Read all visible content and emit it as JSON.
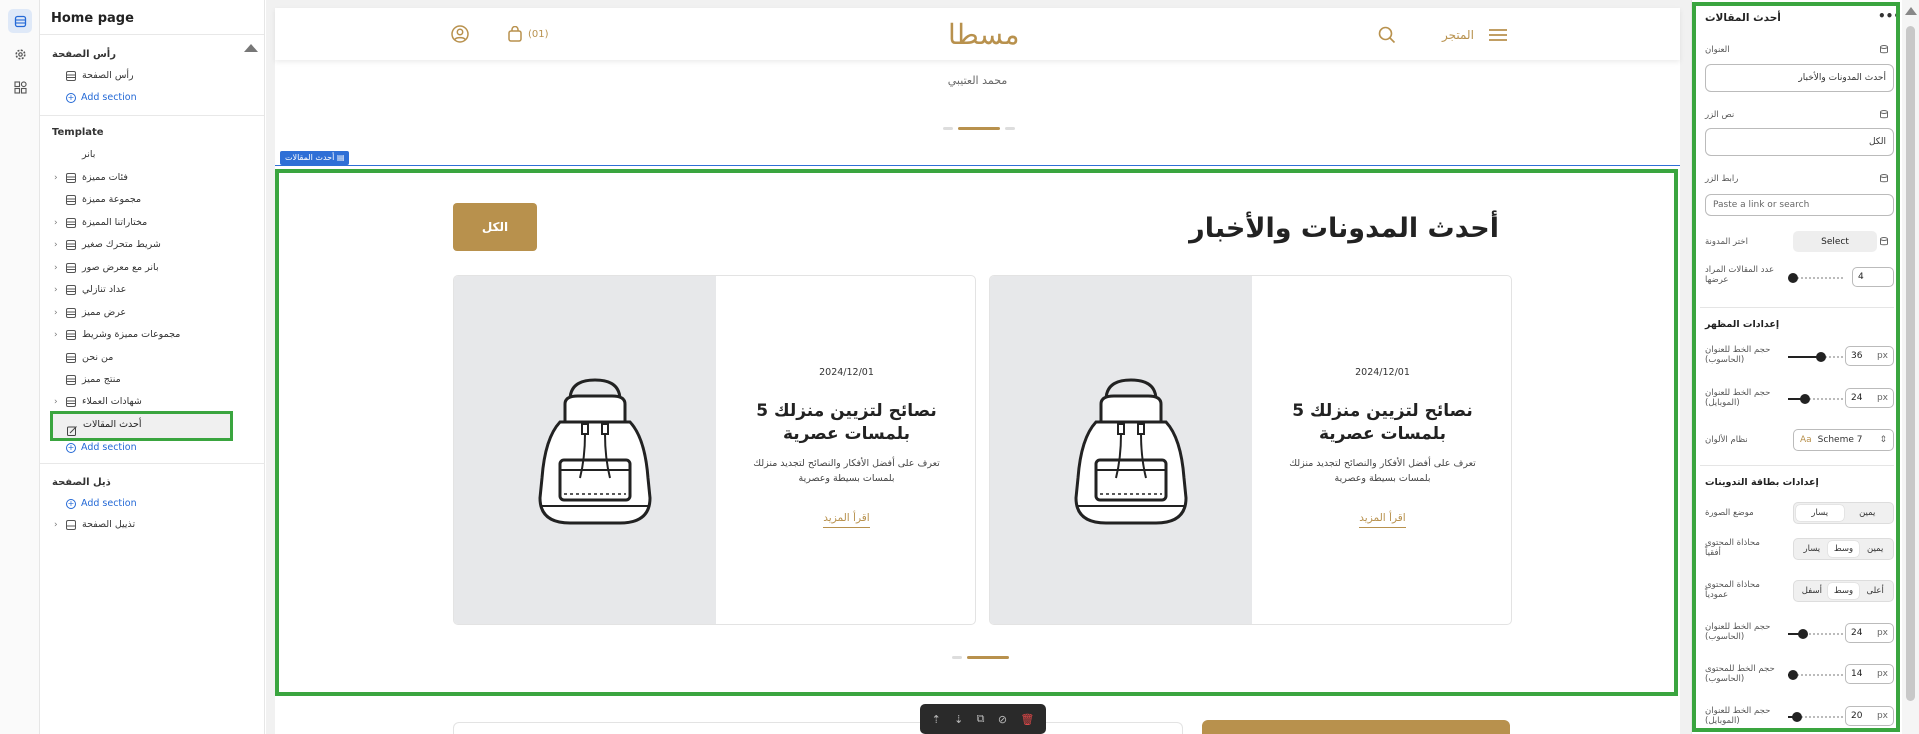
{
  "sidebar": {
    "title": "Home page",
    "header_group": "رأس الصفحة",
    "header_item": "رأس الصفحة",
    "add_section": "Add section",
    "template_label": "Template",
    "template_items": [
      "بانر",
      "فئات مميزة",
      "مجموعة مميزة",
      "مختاراتنا المميزة",
      "شريط متحرك صغير",
      "بانر مع معرض صور",
      "عداد تنازلي",
      "عرض مميز",
      "مجموعات مميزة وشريط",
      "من نحن",
      "منتج مميز",
      "شهادات العملاء",
      "أحدث المقالات"
    ],
    "footer_group": "ذيل الصفحة",
    "footer_item": "تذييل الصفحة"
  },
  "store_header": {
    "menu_label": "المتجر",
    "logo": "مسطا",
    "cart_count": "(01)"
  },
  "testimonial_author": "محمد العتيبي",
  "section_tag": "أحدث المقالات",
  "blog": {
    "title": "أحدث المدونات والأخبار",
    "button": "الكل",
    "cards": [
      {
        "date": "2024/12/01",
        "title": "5 نصائح لتزيين منزلك بلمسات عصرية",
        "excerpt": "تعرف على أفضل الأفكار والنصائح لتجديد منزلك بلمسات بسيطة وعصرية",
        "more": "اقرأ المزيد"
      },
      {
        "date": "2024/12/01",
        "title": "5 نصائح لتزيين منزلك بلمسات عصرية",
        "excerpt": "تعرف على أفضل الأفكار والنصائح لتجديد منزلك بلمسات بسيطة وعصرية",
        "more": "اقرأ المزيد"
      }
    ]
  },
  "panel": {
    "title": "أحدث المقالات",
    "more": "•••",
    "heading_label": "العنوان",
    "heading_value": "أحدث المدونات والأخبار",
    "button_text_label": "نص الزر",
    "button_text_value": "الكل",
    "button_link_label": "رابط الزر",
    "button_link_placeholder": "Paste a link or search",
    "blog_label": "اختر المدونة",
    "blog_select": "Select",
    "count_label": "عدد المقالات المراد عرضها",
    "count_value": "4",
    "appearance_group": "إعدادات المظهر",
    "title_desktop_label": "حجم الخط للعنوان (الحاسوب)",
    "title_desktop_value": "36",
    "title_mobile_label": "حجم الخط للعنوان (الموبايل)",
    "title_mobile_value": "24",
    "scheme_label": "نظام الألوان",
    "scheme_value": "Scheme 7",
    "card_group": "إعدادات بطاقة التدوينات",
    "image_pos_label": "موضع الصورة",
    "image_pos_options": [
      "يسار",
      "يمين"
    ],
    "h_align_label": "محاذاة المحتوى أفقياً",
    "h_align_options": [
      "يسار",
      "وسط",
      "يمين"
    ],
    "v_align_label": "محاذاة المحتوى عمودياً",
    "v_align_options": [
      "أسفل",
      "وسط",
      "أعلى"
    ],
    "card_title_desktop_label": "حجم الخط للعنوان (الحاسوب)",
    "card_title_desktop_value": "24",
    "card_content_desktop_label": "حجم الخط للمحتوى (الحاسوب)",
    "card_content_desktop_value": "14",
    "card_title_mobile_label": "حجم الخط للعنوان (الموبايل)",
    "card_title_mobile_value": "20",
    "unit": "px"
  },
  "colors": {
    "accent": "#b8914d",
    "selection": "#3aa53f",
    "link": "#2469d6",
    "section_tag": "#2f6fd6"
  }
}
